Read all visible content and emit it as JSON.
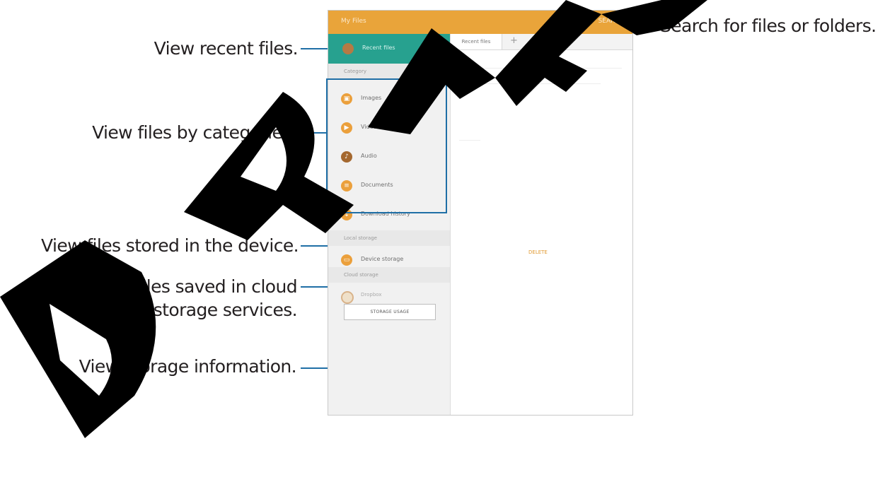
{
  "callouts": {
    "search": "Search for files or folders.",
    "recent": "View recent files.",
    "categories": "View files by categories.",
    "device": "View files stored in the device.",
    "cloud_line1": "View files saved in cloud",
    "cloud_line2": "storage services.",
    "storage_info": "View storage information."
  },
  "app": {
    "title": "My Files",
    "search_label": "SEARCH"
  },
  "sidebar": {
    "recent": "Recent files",
    "categories_header": "Category",
    "categories": [
      {
        "label": "Images",
        "icon": "image-icon"
      },
      {
        "label": "Videos",
        "icon": "video-icon"
      },
      {
        "label": "Audio",
        "icon": "music-icon"
      },
      {
        "label": "Documents",
        "icon": "document-icon"
      },
      {
        "label": "Download history",
        "icon": "download-icon"
      }
    ],
    "local_storage_header": "Local storage",
    "device_storage": "Device storage",
    "cloud_header": "Cloud storage",
    "cloud_item": "Dropbox",
    "storage_usage_button": "STORAGE USAGE"
  },
  "content": {
    "tab_recent": "Recent files",
    "add_tab": "+",
    "storage_text": "DELETE"
  },
  "colors": {
    "accent": "#e9a43a",
    "teal": "#27a18f",
    "callout_line": "#1f6fa6"
  }
}
